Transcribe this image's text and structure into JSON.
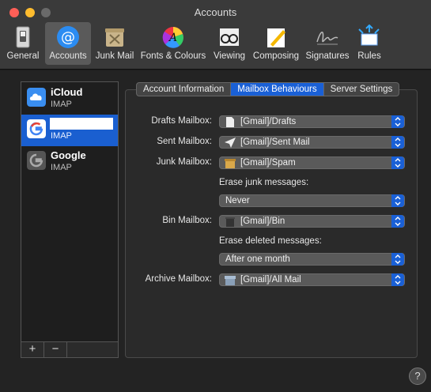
{
  "window": {
    "title": "Accounts"
  },
  "toolbar": {
    "items": [
      {
        "label": "General",
        "icon": "general-switch-icon"
      },
      {
        "label": "Accounts",
        "icon": "at-sign-icon",
        "active": true
      },
      {
        "label": "Junk Mail",
        "icon": "junk-bin-icon"
      },
      {
        "label": "Fonts & Colours",
        "icon": "color-wheel-icon"
      },
      {
        "label": "Viewing",
        "icon": "glasses-icon"
      },
      {
        "label": "Composing",
        "icon": "pencil-paper-icon"
      },
      {
        "label": "Signatures",
        "icon": "signature-icon"
      },
      {
        "label": "Rules",
        "icon": "envelope-arrows-icon"
      }
    ]
  },
  "accounts": [
    {
      "name": "iCloud",
      "type": "IMAP",
      "icon": "icloud-icon"
    },
    {
      "name": "",
      "type": "IMAP",
      "icon": "google-icon",
      "selected": true
    },
    {
      "name": "Google",
      "type": "IMAP",
      "icon": "google-icon"
    }
  ],
  "list_footer": {
    "add": "+",
    "remove": "−"
  },
  "tabs": [
    {
      "label": "Account Information"
    },
    {
      "label": "Mailbox Behaviours",
      "active": true
    },
    {
      "label": "Server Settings"
    }
  ],
  "mailbox": {
    "drafts_label": "Drafts Mailbox:",
    "drafts_value": "[Gmail]/Drafts",
    "sent_label": "Sent Mailbox:",
    "sent_value": "[Gmail]/Sent Mail",
    "junk_label": "Junk Mailbox:",
    "junk_value": "[Gmail]/Spam",
    "erase_junk_label": "Erase junk messages:",
    "erase_junk_value": "Never",
    "bin_label": "Bin Mailbox:",
    "bin_value": "[Gmail]/Bin",
    "erase_deleted_label": "Erase deleted messages:",
    "erase_deleted_value": "After one month",
    "archive_label": "Archive Mailbox:",
    "archive_value": "[Gmail]/All Mail"
  },
  "help": "?",
  "colors": {
    "accent": "#1a60d6",
    "window_bg": "#232323",
    "toolbar_bg": "#3a3a3a"
  }
}
